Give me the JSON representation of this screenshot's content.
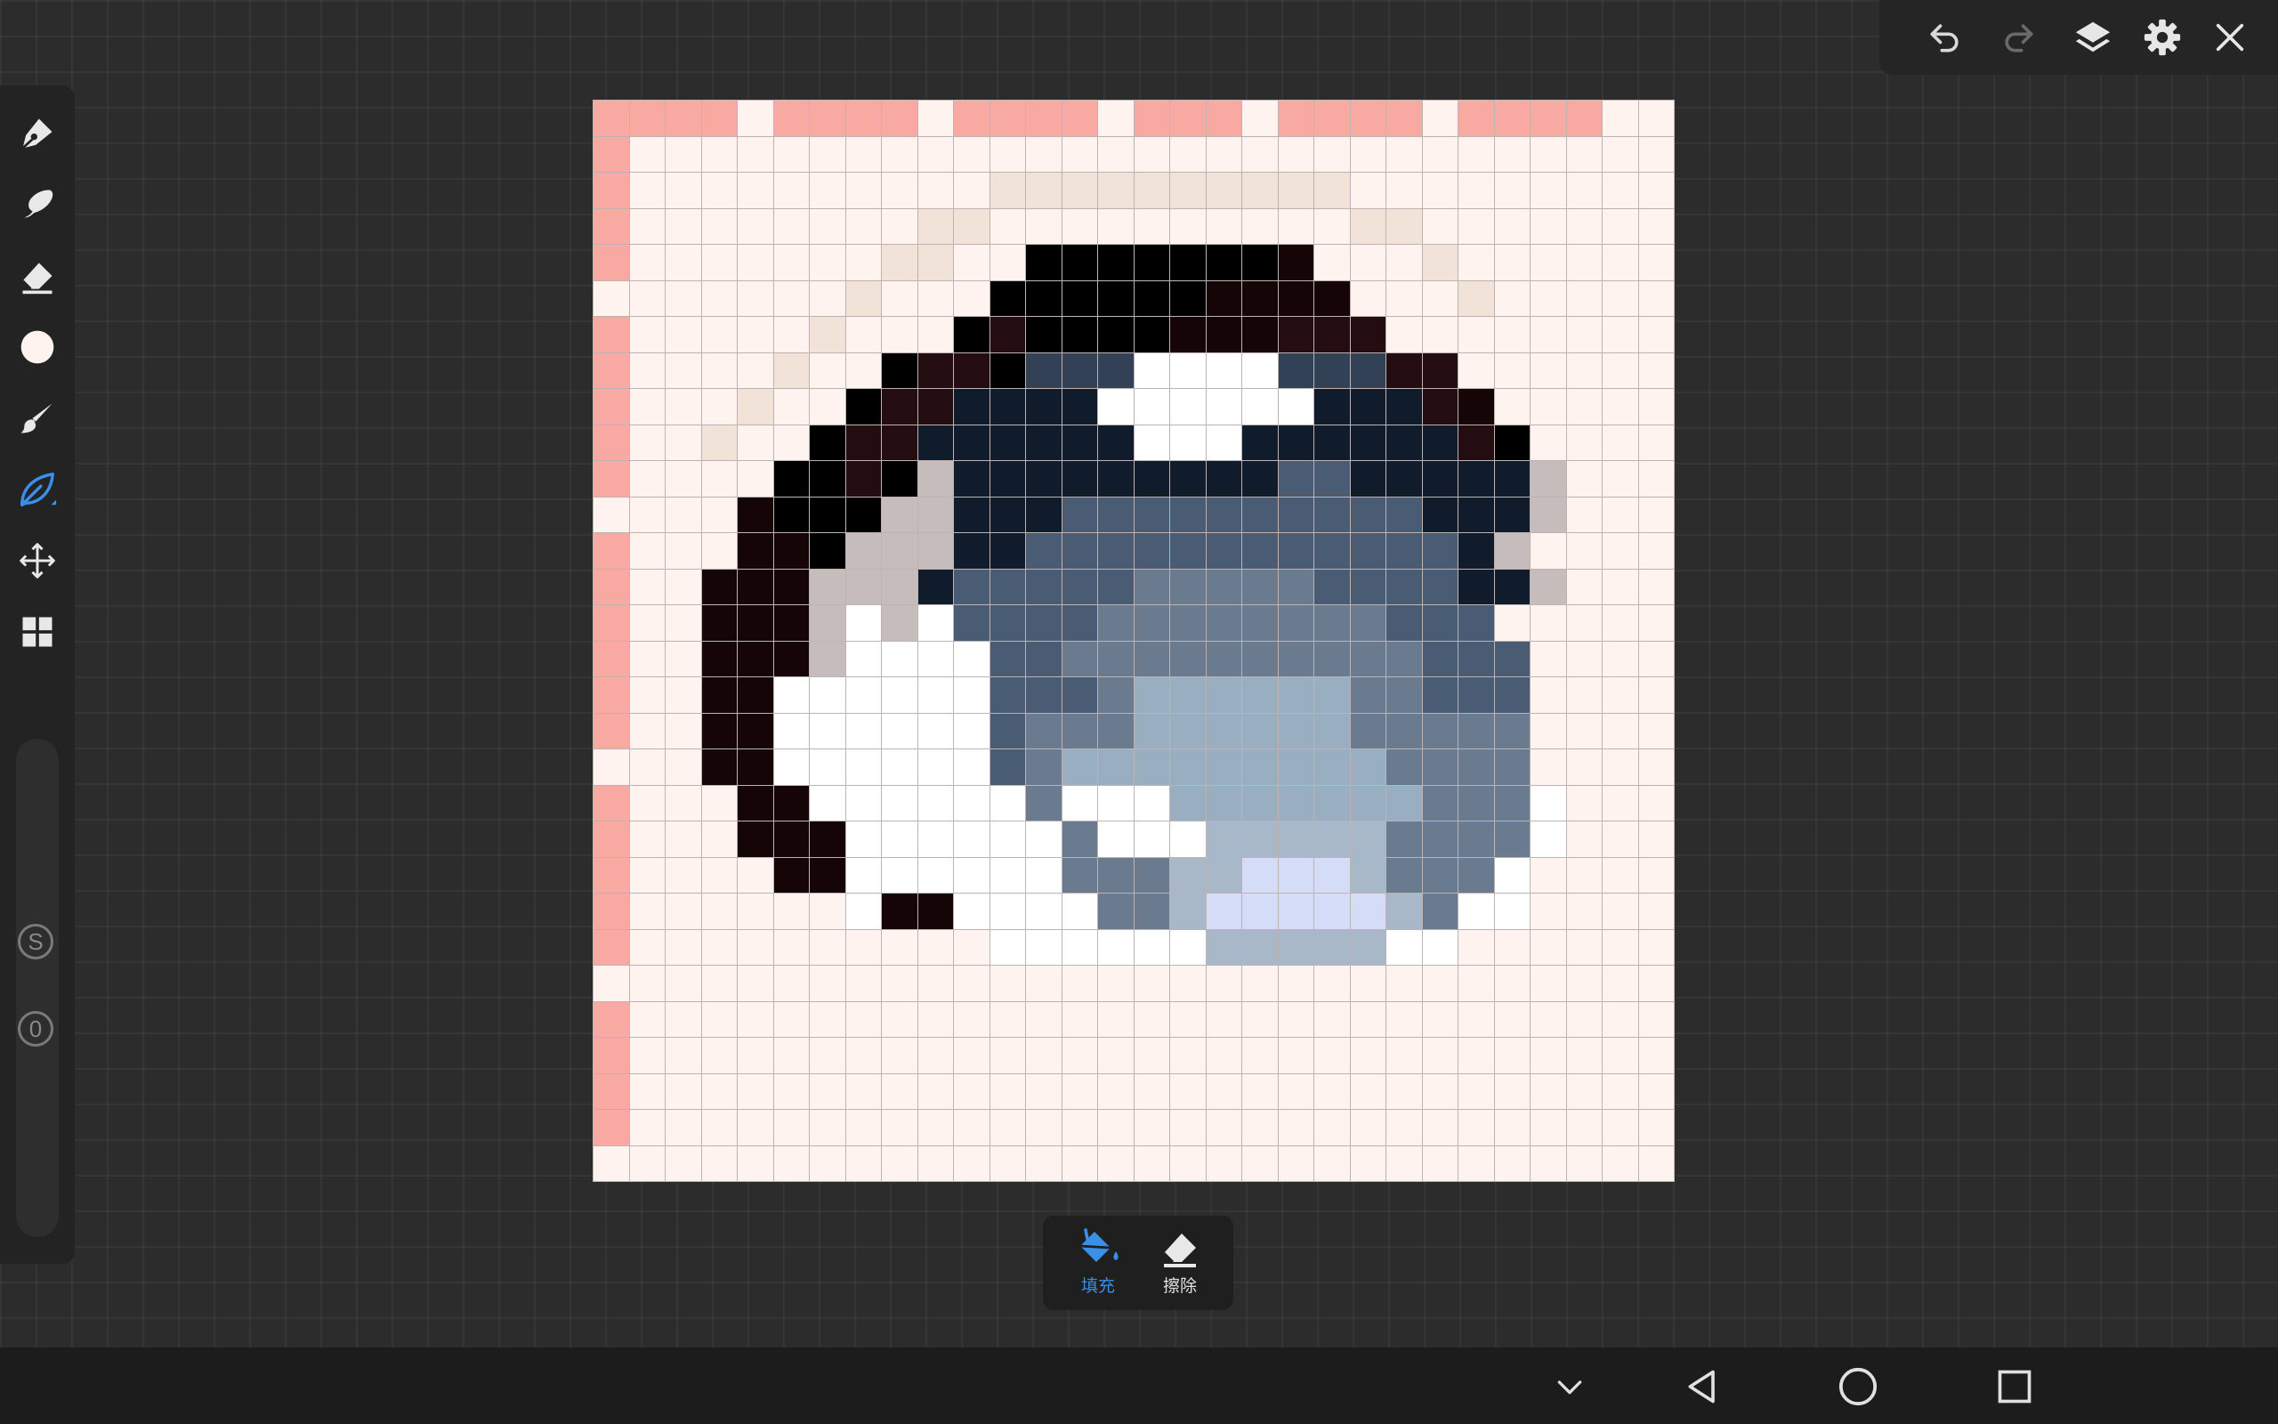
{
  "toolbar_top": {
    "icons": [
      "undo-icon",
      "redo-icon",
      "layers-icon",
      "gear-icon",
      "close-icon"
    ],
    "redo_enabled": false
  },
  "toolbar_left": {
    "tools": [
      "pen-icon",
      "smudge-icon",
      "eraser-icon",
      "color-icon",
      "brush-icon",
      "leaf-tool-icon",
      "move-icon",
      "grid-icon"
    ],
    "active_tool": "leaf-tool-icon",
    "current_color": "#fff3ef",
    "accent_color": "#3a8fe8",
    "size_label": "S",
    "opacity_label": "0"
  },
  "canvas": {
    "grid_size": 30,
    "palette": {
      "a": "#fff3ef",
      "p": "#f8aaa2",
      "e": "#f1e3d8",
      "k": "#000000",
      "d": "#150507",
      "r": "#230d10",
      "n": "#101b2c",
      "s": "#324155",
      "m": "#4a5c73",
      "g": "#6a7b90",
      "l": "#9aaec2",
      "c": "#a9b8c8",
      "v": "#d5dcf7",
      "t": "#c7bcbc",
      "w": "#ffffff"
    },
    "rows": [
      "ppppappppappppapppappppappppaa",
      "paaaaaaaaaaaaaaaaaaaaaaaaaaaaa",
      "paaaaaaaaaaeeeeeeeeeeaaaaaaaaa",
      "paaaaaaaaeeaaaaaaaaaaeeaaaaaaa",
      "paaaaaaaeeaakkkkkkkdaaaeaaaaaa",
      "aaaaaaaeaaakkkkkkddddaaaeaaaaa",
      "paaaaaeaaakrkkkkdddrrraaaaaaaa",
      "paaaaeaakrrkssswwwwsssrraaaaaa",
      "paaaeaakrrnnnnwwwwwwnnnrdaaaaa",
      "paaeaakrrnnnnnnwwwnnnnnnrkaaaa",
      "paaaakkrktnnnnnnnnnmmnnnnntaaa",
      "aaaadkkkttnnnmmmmmmmmmmnnntaaa",
      "paaaddktttnnmmmmmmmmmmmmntaaaa",
      "paadddtttnmmmmmgggggmmmmnntaaa",
      "paadddtwtwmmmmggggggggmmmaaaaa",
      "paadddtwwwwmmggggggggggmmmaaaa",
      "paaddwwwwwwmmmgllllllggmmmaaaa",
      "paaddwwwwwwmgggllllllgggggaaaa",
      "aaaddwwwwwwmglllllllllggggaaaa",
      "paaaddwwwwwwgwwwlllllllgggwaaa",
      "paaadddwwwwwwgwwwcccccggggwaaa",
      "paaaaddwwwwwwgggccvvvcgggwaaaa",
      "paaaaaawddwwwwggcvvvvvcgwwaaaa",
      "paaaaaaaaaawwwwwwcccccwwaaaaaa",
      "aaaaaaaaaaaaaaaaaaaaaaaaaaaaaa",
      "paaaaaaaaaaaaaaaaaaaaaaaaaaaaa",
      "paaaaaaaaaaaaaaaaaaaaaaaaaaaaa",
      "paaaaaaaaaaaaaaaaaaaaaaaaaaaaa",
      "paaaaaaaaaaaaaaaaaaaaaaaaaaaaa",
      "aaaaaaaaaaaaaaaaaaaaaaaaaaaaaa"
    ]
  },
  "popup": {
    "fill_label": "填充",
    "erase_label": "擦除",
    "selected": "fill"
  },
  "navbar": {
    "icons": [
      "chevron-down-icon",
      "back-icon",
      "home-icon",
      "recents-icon"
    ]
  }
}
